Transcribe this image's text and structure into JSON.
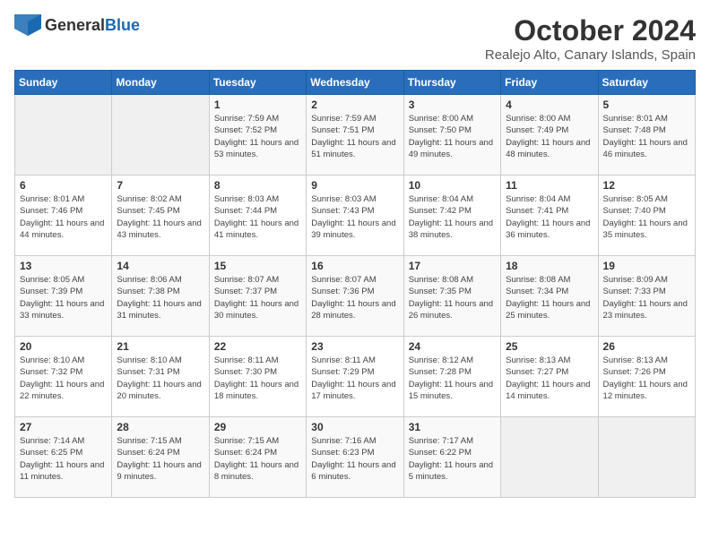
{
  "logo": {
    "general": "General",
    "blue": "Blue"
  },
  "title": "October 2024",
  "location": "Realejo Alto, Canary Islands, Spain",
  "days_of_week": [
    "Sunday",
    "Monday",
    "Tuesday",
    "Wednesday",
    "Thursday",
    "Friday",
    "Saturday"
  ],
  "weeks": [
    [
      {
        "day": "",
        "empty": true
      },
      {
        "day": "",
        "empty": true
      },
      {
        "day": "1",
        "sunrise": "Sunrise: 7:59 AM",
        "sunset": "Sunset: 7:52 PM",
        "daylight": "Daylight: 11 hours and 53 minutes."
      },
      {
        "day": "2",
        "sunrise": "Sunrise: 7:59 AM",
        "sunset": "Sunset: 7:51 PM",
        "daylight": "Daylight: 11 hours and 51 minutes."
      },
      {
        "day": "3",
        "sunrise": "Sunrise: 8:00 AM",
        "sunset": "Sunset: 7:50 PM",
        "daylight": "Daylight: 11 hours and 49 minutes."
      },
      {
        "day": "4",
        "sunrise": "Sunrise: 8:00 AM",
        "sunset": "Sunset: 7:49 PM",
        "daylight": "Daylight: 11 hours and 48 minutes."
      },
      {
        "day": "5",
        "sunrise": "Sunrise: 8:01 AM",
        "sunset": "Sunset: 7:48 PM",
        "daylight": "Daylight: 11 hours and 46 minutes."
      }
    ],
    [
      {
        "day": "6",
        "sunrise": "Sunrise: 8:01 AM",
        "sunset": "Sunset: 7:46 PM",
        "daylight": "Daylight: 11 hours and 44 minutes."
      },
      {
        "day": "7",
        "sunrise": "Sunrise: 8:02 AM",
        "sunset": "Sunset: 7:45 PM",
        "daylight": "Daylight: 11 hours and 43 minutes."
      },
      {
        "day": "8",
        "sunrise": "Sunrise: 8:03 AM",
        "sunset": "Sunset: 7:44 PM",
        "daylight": "Daylight: 11 hours and 41 minutes."
      },
      {
        "day": "9",
        "sunrise": "Sunrise: 8:03 AM",
        "sunset": "Sunset: 7:43 PM",
        "daylight": "Daylight: 11 hours and 39 minutes."
      },
      {
        "day": "10",
        "sunrise": "Sunrise: 8:04 AM",
        "sunset": "Sunset: 7:42 PM",
        "daylight": "Daylight: 11 hours and 38 minutes."
      },
      {
        "day": "11",
        "sunrise": "Sunrise: 8:04 AM",
        "sunset": "Sunset: 7:41 PM",
        "daylight": "Daylight: 11 hours and 36 minutes."
      },
      {
        "day": "12",
        "sunrise": "Sunrise: 8:05 AM",
        "sunset": "Sunset: 7:40 PM",
        "daylight": "Daylight: 11 hours and 35 minutes."
      }
    ],
    [
      {
        "day": "13",
        "sunrise": "Sunrise: 8:05 AM",
        "sunset": "Sunset: 7:39 PM",
        "daylight": "Daylight: 11 hours and 33 minutes."
      },
      {
        "day": "14",
        "sunrise": "Sunrise: 8:06 AM",
        "sunset": "Sunset: 7:38 PM",
        "daylight": "Daylight: 11 hours and 31 minutes."
      },
      {
        "day": "15",
        "sunrise": "Sunrise: 8:07 AM",
        "sunset": "Sunset: 7:37 PM",
        "daylight": "Daylight: 11 hours and 30 minutes."
      },
      {
        "day": "16",
        "sunrise": "Sunrise: 8:07 AM",
        "sunset": "Sunset: 7:36 PM",
        "daylight": "Daylight: 11 hours and 28 minutes."
      },
      {
        "day": "17",
        "sunrise": "Sunrise: 8:08 AM",
        "sunset": "Sunset: 7:35 PM",
        "daylight": "Daylight: 11 hours and 26 minutes."
      },
      {
        "day": "18",
        "sunrise": "Sunrise: 8:08 AM",
        "sunset": "Sunset: 7:34 PM",
        "daylight": "Daylight: 11 hours and 25 minutes."
      },
      {
        "day": "19",
        "sunrise": "Sunrise: 8:09 AM",
        "sunset": "Sunset: 7:33 PM",
        "daylight": "Daylight: 11 hours and 23 minutes."
      }
    ],
    [
      {
        "day": "20",
        "sunrise": "Sunrise: 8:10 AM",
        "sunset": "Sunset: 7:32 PM",
        "daylight": "Daylight: 11 hours and 22 minutes."
      },
      {
        "day": "21",
        "sunrise": "Sunrise: 8:10 AM",
        "sunset": "Sunset: 7:31 PM",
        "daylight": "Daylight: 11 hours and 20 minutes."
      },
      {
        "day": "22",
        "sunrise": "Sunrise: 8:11 AM",
        "sunset": "Sunset: 7:30 PM",
        "daylight": "Daylight: 11 hours and 18 minutes."
      },
      {
        "day": "23",
        "sunrise": "Sunrise: 8:11 AM",
        "sunset": "Sunset: 7:29 PM",
        "daylight": "Daylight: 11 hours and 17 minutes."
      },
      {
        "day": "24",
        "sunrise": "Sunrise: 8:12 AM",
        "sunset": "Sunset: 7:28 PM",
        "daylight": "Daylight: 11 hours and 15 minutes."
      },
      {
        "day": "25",
        "sunrise": "Sunrise: 8:13 AM",
        "sunset": "Sunset: 7:27 PM",
        "daylight": "Daylight: 11 hours and 14 minutes."
      },
      {
        "day": "26",
        "sunrise": "Sunrise: 8:13 AM",
        "sunset": "Sunset: 7:26 PM",
        "daylight": "Daylight: 11 hours and 12 minutes."
      }
    ],
    [
      {
        "day": "27",
        "sunrise": "Sunrise: 7:14 AM",
        "sunset": "Sunset: 6:25 PM",
        "daylight": "Daylight: 11 hours and 11 minutes."
      },
      {
        "day": "28",
        "sunrise": "Sunrise: 7:15 AM",
        "sunset": "Sunset: 6:24 PM",
        "daylight": "Daylight: 11 hours and 9 minutes."
      },
      {
        "day": "29",
        "sunrise": "Sunrise: 7:15 AM",
        "sunset": "Sunset: 6:24 PM",
        "daylight": "Daylight: 11 hours and 8 minutes."
      },
      {
        "day": "30",
        "sunrise": "Sunrise: 7:16 AM",
        "sunset": "Sunset: 6:23 PM",
        "daylight": "Daylight: 11 hours and 6 minutes."
      },
      {
        "day": "31",
        "sunrise": "Sunrise: 7:17 AM",
        "sunset": "Sunset: 6:22 PM",
        "daylight": "Daylight: 11 hours and 5 minutes."
      },
      {
        "day": "",
        "empty": true
      },
      {
        "day": "",
        "empty": true
      }
    ]
  ]
}
